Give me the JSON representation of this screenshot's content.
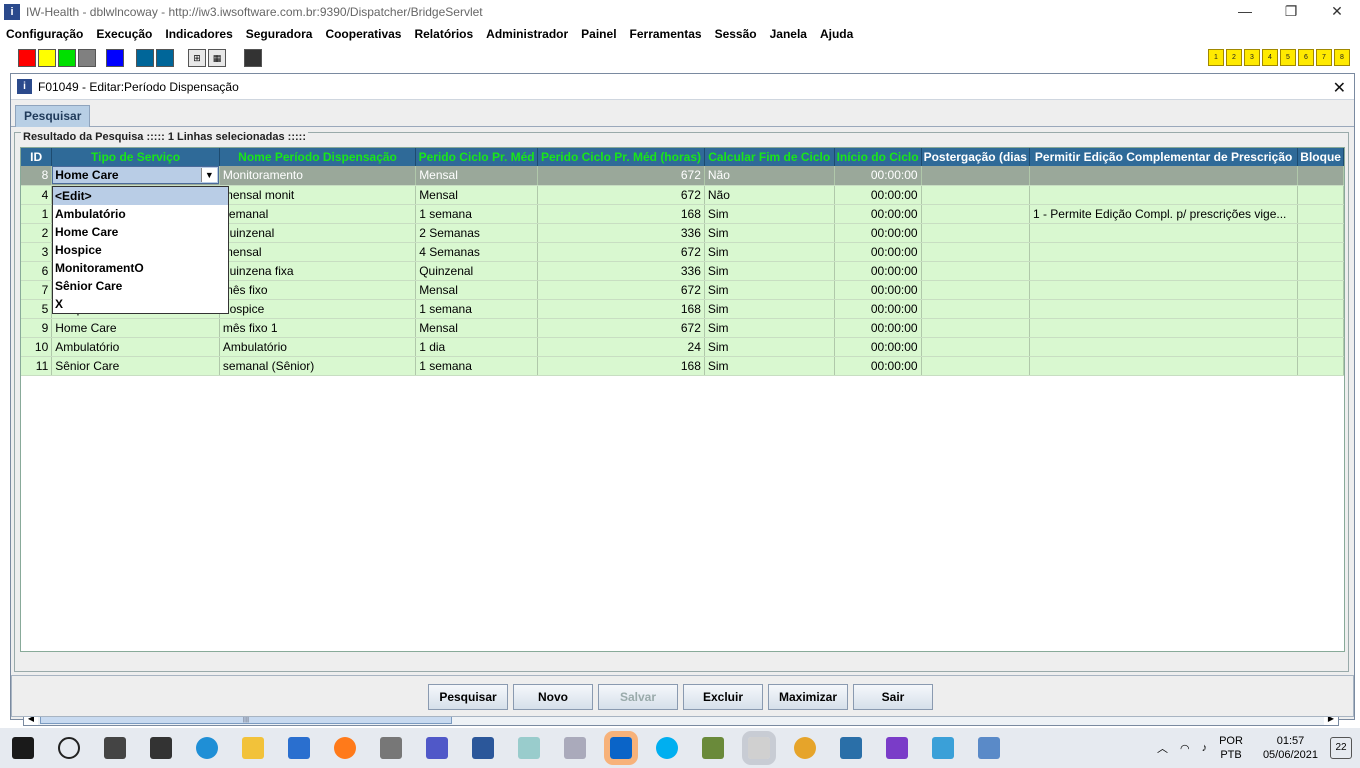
{
  "window": {
    "title": "IW-Health - dblwlncoway - http://iw3.iwsoftware.com.br:9390/Dispatcher/BridgeServlet"
  },
  "menu": [
    "Configuração",
    "Execução",
    "Indicadores",
    "Seguradora",
    "Cooperativas",
    "Relatórios",
    "Administrador",
    "Painel",
    "Ferramentas",
    "Sessão",
    "Janela",
    "Ajuda"
  ],
  "toolbar": {
    "swatches": [
      "#ff0000",
      "#ffff00",
      "#00e000",
      "#808080"
    ],
    "blue_swatches": [
      "#0000ff",
      "#006699",
      "#006699"
    ],
    "num_buttons": [
      "1",
      "2",
      "3",
      "4",
      "5",
      "6",
      "7",
      "8"
    ]
  },
  "frame": {
    "title": "F01049 - Editar:Período Dispensação",
    "tab": "Pesquisar",
    "group_label": "Resultado da Pesquisa ::::: 1 Linhas selecionadas :::::"
  },
  "table": {
    "columns": [
      "ID",
      "Tipo de Serviço",
      "Nome Período Dispensação",
      "Perido Ciclo Pr. Méd",
      "Perido Ciclo Pr. Méd (horas)",
      "Calcular Fim de Ciclo",
      "Início do Ciclo",
      "Postergação (dias",
      "Permitir Edição Complementar de Prescrição",
      "Bloque"
    ],
    "rows": [
      {
        "id": "8",
        "tipo": "Home Care",
        "nome": "Monitoramento",
        "ciclo": "Mensal",
        "horas": "672",
        "calc": "Não",
        "inicio": "00:00:00",
        "post": "",
        "perm": ""
      },
      {
        "id": "4",
        "tipo": "",
        "nome": "mensal monit",
        "ciclo": "Mensal",
        "horas": "672",
        "calc": "Não",
        "inicio": "00:00:00",
        "post": "",
        "perm": ""
      },
      {
        "id": "1",
        "tipo": "",
        "nome": "semanal",
        "ciclo": "1 semana",
        "horas": "168",
        "calc": "Sim",
        "inicio": "00:00:00",
        "post": "",
        "perm": "1 - Permite Edição Compl. p/ prescrições vige..."
      },
      {
        "id": "2",
        "tipo": "",
        "nome": "quinzenal",
        "ciclo": "2 Semanas",
        "horas": "336",
        "calc": "Sim",
        "inicio": "00:00:00",
        "post": "",
        "perm": ""
      },
      {
        "id": "3",
        "tipo": "",
        "nome": "mensal",
        "ciclo": "4 Semanas",
        "horas": "672",
        "calc": "Sim",
        "inicio": "00:00:00",
        "post": "",
        "perm": ""
      },
      {
        "id": "6",
        "tipo": "",
        "nome": "quinzena fixa",
        "ciclo": "Quinzenal",
        "horas": "336",
        "calc": "Sim",
        "inicio": "00:00:00",
        "post": "",
        "perm": ""
      },
      {
        "id": "7",
        "tipo": "",
        "nome": "mês fixo",
        "ciclo": "Mensal",
        "horas": "672",
        "calc": "Sim",
        "inicio": "00:00:00",
        "post": "",
        "perm": ""
      },
      {
        "id": "5",
        "tipo": "Hospice",
        "nome": "hospice",
        "ciclo": "1 semana",
        "horas": "168",
        "calc": "Sim",
        "inicio": "00:00:00",
        "post": "",
        "perm": ""
      },
      {
        "id": "9",
        "tipo": "Home Care",
        "nome": "mês fixo 1",
        "ciclo": "Mensal",
        "horas": "672",
        "calc": "Sim",
        "inicio": "00:00:00",
        "post": "",
        "perm": ""
      },
      {
        "id": "10",
        "tipo": "Ambulatório",
        "nome": "Ambulatório",
        "ciclo": "1 dia",
        "horas": "24",
        "calc": "Sim",
        "inicio": "00:00:00",
        "post": "",
        "perm": ""
      },
      {
        "id": "11",
        "tipo": "Sênior Care",
        "nome": "semanal (Sênior)",
        "ciclo": "1 semana",
        "horas": "168",
        "calc": "Sim",
        "inicio": "00:00:00",
        "post": "",
        "perm": ""
      }
    ]
  },
  "dropdown": {
    "current": "Home Care",
    "options": [
      "<Edit>",
      "Ambulatório",
      "Home Care",
      "Hospice",
      "MonitoramentO",
      "Sênior Care",
      "X"
    ]
  },
  "buttons": {
    "pesquisar": "Pesquisar",
    "novo": "Novo",
    "salvar": "Salvar",
    "excluir": "Excluir",
    "maximizar": "Maximizar",
    "sair": "Sair"
  },
  "taskbar": {
    "lang_top": "POR",
    "lang_bottom": "PTB",
    "time": "01:57",
    "date": "05/06/2021",
    "notifications": "22"
  }
}
